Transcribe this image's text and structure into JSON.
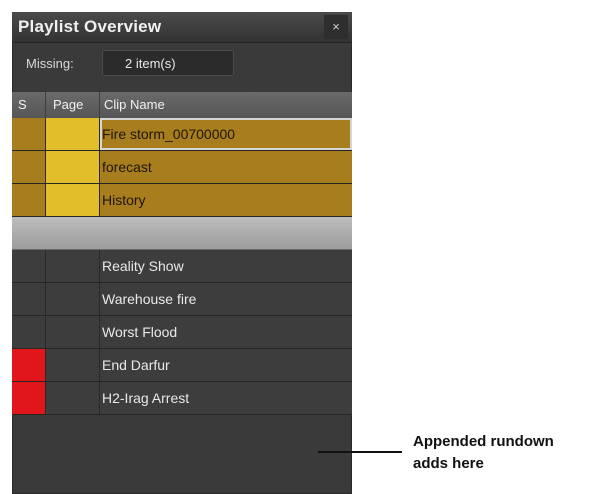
{
  "panel": {
    "title": "Playlist Overview",
    "close_glyph": "×",
    "missing": {
      "label": "Missing:",
      "value": "2 item(s)"
    },
    "columns": {
      "s": "S",
      "page": "Page",
      "clip": "Clip Name"
    },
    "rows": [
      {
        "name": "Fire storm_00700000",
        "kind": "selected",
        "active": true,
        "status_color": "",
        "page_color": "#e2bf2a"
      },
      {
        "name": "forecast",
        "kind": "selected",
        "active": false,
        "status_color": "",
        "page_color": "#e2bf2a"
      },
      {
        "name": "History",
        "kind": "selected",
        "active": false,
        "status_color": "",
        "page_color": "#e2bf2a"
      },
      {
        "name": "",
        "kind": "separator",
        "active": false,
        "status_color": "",
        "page_color": ""
      },
      {
        "name": "Reality Show",
        "kind": "dark",
        "active": false,
        "status_color": "",
        "page_color": ""
      },
      {
        "name": "Warehouse fire",
        "kind": "dark",
        "active": false,
        "status_color": "",
        "page_color": ""
      },
      {
        "name": "Worst Flood",
        "kind": "dark",
        "active": false,
        "status_color": "",
        "page_color": ""
      },
      {
        "name": "End Darfur",
        "kind": "dark",
        "active": false,
        "status_color": "#e1161b",
        "page_color": ""
      },
      {
        "name": "H2-Irag Arrest",
        "kind": "dark",
        "active": false,
        "status_color": "#e1161b",
        "page_color": ""
      }
    ]
  },
  "annotation": {
    "line1": "Appended rundown",
    "line2": "adds here"
  }
}
